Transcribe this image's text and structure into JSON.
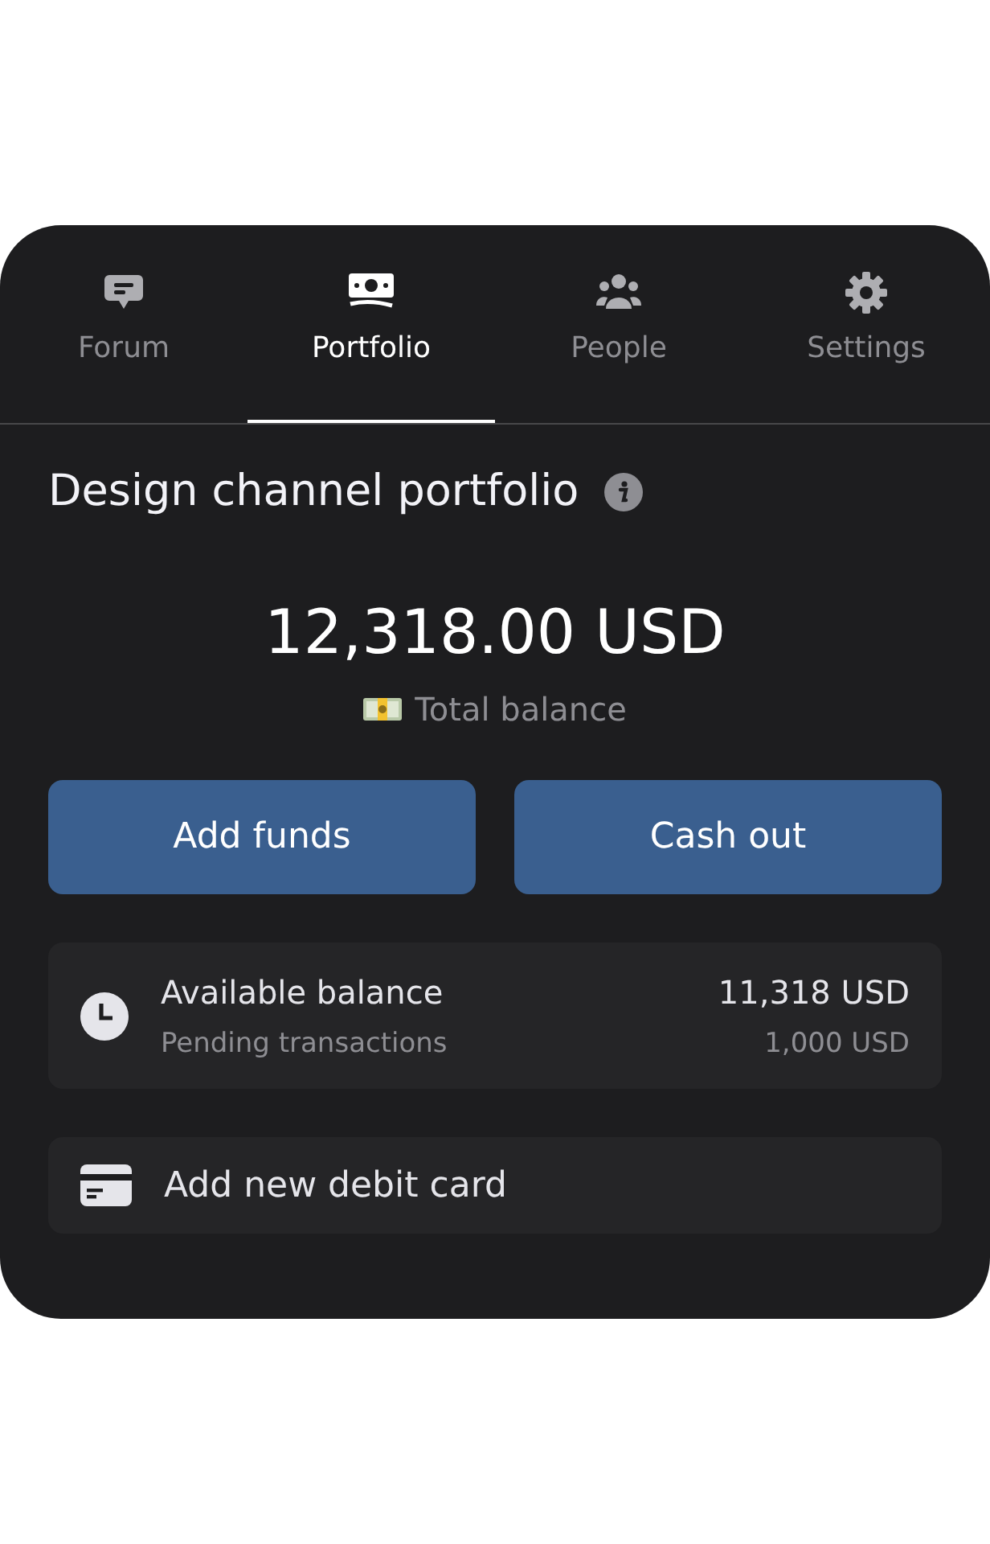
{
  "tabs": [
    {
      "label": "Forum",
      "selected": false
    },
    {
      "label": "Portfolio",
      "selected": true
    },
    {
      "label": "People",
      "selected": false
    },
    {
      "label": "Settings",
      "selected": false
    }
  ],
  "title": "Design channel portfolio",
  "balance": {
    "amount": "12,318.00 USD",
    "label": "Total balance"
  },
  "buttons": [
    "Add funds",
    "Cash out"
  ],
  "summary": {
    "available_label": "Available balance",
    "available_value": "11,318 USD",
    "pending_label": "Pending transactions",
    "pending_value": "1,000 USD"
  },
  "add_card": "Add new debit card"
}
